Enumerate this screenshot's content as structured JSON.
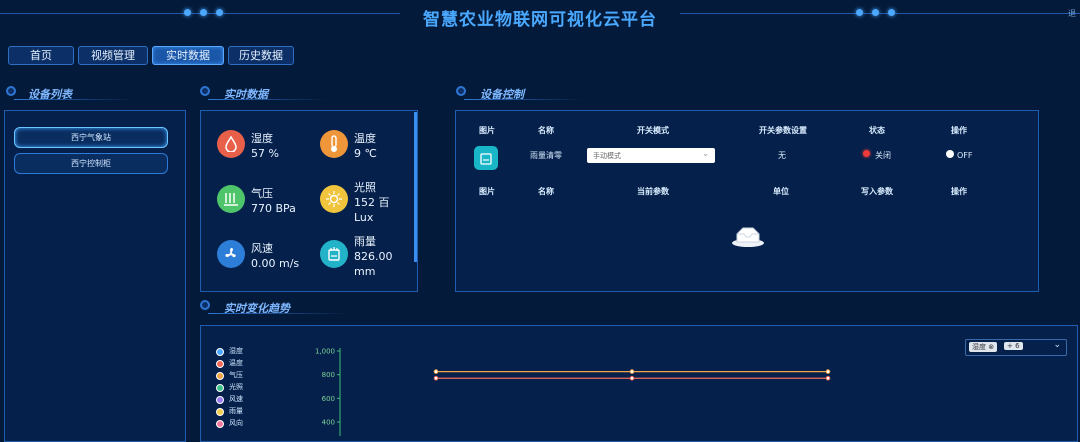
{
  "header": {
    "title": "智慧农业物联网可视化云平台",
    "right_text": "退"
  },
  "nav": {
    "items": [
      {
        "label": "首页"
      },
      {
        "label": "视频管理"
      },
      {
        "label": "实时数据"
      },
      {
        "label": "历史数据"
      }
    ],
    "active": "实时数据"
  },
  "device_list": {
    "title": "设备列表",
    "items": [
      {
        "label": "西宁气象站"
      },
      {
        "label": "西宁控制柜"
      }
    ],
    "selected": "西宁气象站"
  },
  "realtime": {
    "title": "实时数据",
    "sensors": [
      {
        "name": "湿度",
        "value": "57 %",
        "icon": "drop-icon",
        "color": "#e8604a"
      },
      {
        "name": "温度",
        "value": "9 ℃",
        "icon": "thermometer-icon",
        "color": "#f0963a"
      },
      {
        "name": "气压",
        "value": "770 BPa",
        "icon": "pressure-icon",
        "color": "#4fc56b"
      },
      {
        "name": "光照",
        "value": "152 百",
        "value2": "Lux",
        "icon": "sun-icon",
        "color": "#f1c43d"
      },
      {
        "name": "风速",
        "value": "0.00 m/s",
        "icon": "fan-icon",
        "color": "#2d7ed8"
      },
      {
        "name": "雨量",
        "value": "826.00",
        "value2": "mm",
        "icon": "rain-gauge-icon",
        "color": "#22b3c8"
      }
    ]
  },
  "control": {
    "title": "设备控制",
    "header1": [
      "图片",
      "名称",
      "开关模式",
      "开关参数设置",
      "状态",
      "操作"
    ],
    "row": {
      "name": "雨量清零",
      "mode_value": "手动模式",
      "param": "无",
      "status": "关闭",
      "op": "OFF"
    },
    "header2": [
      "图片",
      "名称",
      "当前参数",
      "单位",
      "写入参数",
      "操作"
    ]
  },
  "trend": {
    "title": "实时变化趋势",
    "select": {
      "tag": "湿度",
      "extra": "+ 6"
    },
    "legend": [
      {
        "name": "湿度",
        "color": "#4aa8ff"
      },
      {
        "name": "温度",
        "color": "#f06a5a"
      },
      {
        "name": "气压",
        "color": "#f0a54a"
      },
      {
        "name": "光照",
        "color": "#3ec28a"
      },
      {
        "name": "风速",
        "color": "#9a7cf0"
      },
      {
        "name": "雨量",
        "color": "#f0d04a"
      },
      {
        "name": "风向",
        "color": "#f07aa0"
      }
    ]
  },
  "chart_data": {
    "type": "line",
    "ylabel": "",
    "ylim": [
      0,
      1000
    ],
    "yticks": [
      "1,000",
      "800",
      "600",
      "400"
    ],
    "x": [
      1,
      2,
      3
    ],
    "series": [
      {
        "name": "雨量",
        "values": [
          826,
          826,
          826
        ],
        "color": "#f0a54a"
      },
      {
        "name": "气压",
        "values": [
          770,
          770,
          770
        ],
        "color": "#f06a5a"
      }
    ]
  }
}
